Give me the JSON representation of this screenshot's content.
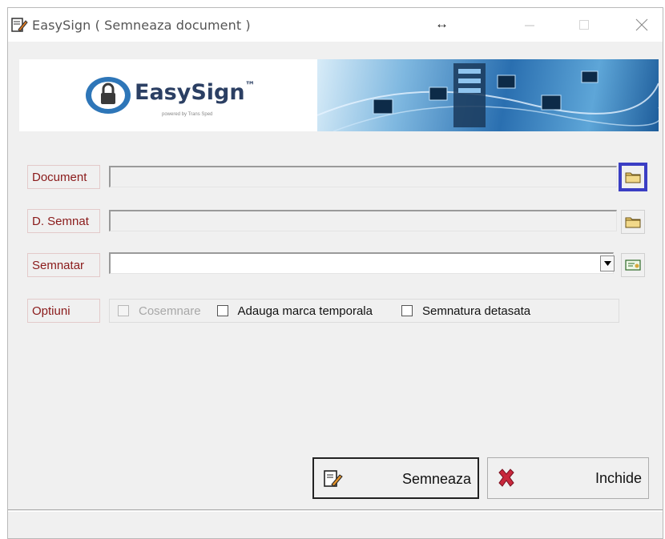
{
  "window": {
    "title": "EasySign ( Semneaza document )",
    "resize_glyph": "↔",
    "controls": [
      "minimize-icon",
      "maximize-icon",
      "close-icon"
    ]
  },
  "banner": {
    "logo_name": "EasySign",
    "logo_tm": "™",
    "logo_tagline": "powered by Trans Sped"
  },
  "form": {
    "document": {
      "label": "Document",
      "value": ""
    },
    "d_semnat": {
      "label": "D. Semnat",
      "value": ""
    },
    "semnatar": {
      "label": "Semnatar",
      "value": ""
    },
    "optiuni": {
      "label": "Optiuni",
      "items": [
        {
          "label": "Cosemnare",
          "checked": false,
          "enabled": false
        },
        {
          "label": "Adauga marca temporala",
          "checked": false,
          "enabled": true
        },
        {
          "label": "Semnatura detasata",
          "checked": false,
          "enabled": true
        }
      ]
    }
  },
  "buttons": {
    "sign": "Semneaza",
    "close": "Inchide"
  },
  "colors": {
    "label_text": "#8a1a1a",
    "highlight_border": "#3b3ec4",
    "close_x": "#c8283c"
  }
}
